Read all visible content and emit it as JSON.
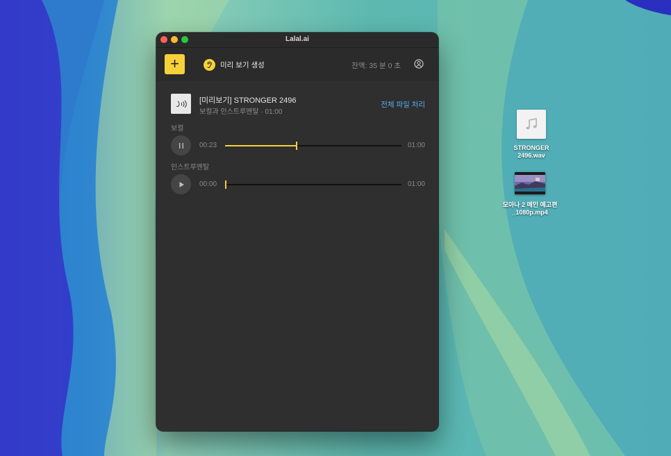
{
  "window": {
    "title": "Lalal.ai"
  },
  "toolbar": {
    "add_label": "+",
    "preview_label": "미리 보기 생성",
    "balance": "잔액: 35 분 0 초"
  },
  "file": {
    "title": "[미리보기] STRONGER 2496",
    "subtitle": "보컬과 인스트루멘탈 · 01:00",
    "process_link": "전체 파일 처리"
  },
  "tracks": [
    {
      "label": "보컬",
      "current": "00:23",
      "duration": "01:00",
      "progress": 0.4,
      "playing": true
    },
    {
      "label": "인스트루멘탈",
      "current": "00:00",
      "duration": "01:00",
      "progress": 0.0,
      "playing": false
    }
  ],
  "desktop": {
    "wav_name_line1": "STRONGER",
    "wav_name_line2": "2496.wav",
    "mp4_name_line1": "모아나 2 메인 예고편",
    "mp4_name_line2": "_1080p.mp4"
  },
  "colors": {
    "accent": "#f7d13a",
    "link": "#5aa9ee",
    "window_bg": "#2f2f2f"
  }
}
